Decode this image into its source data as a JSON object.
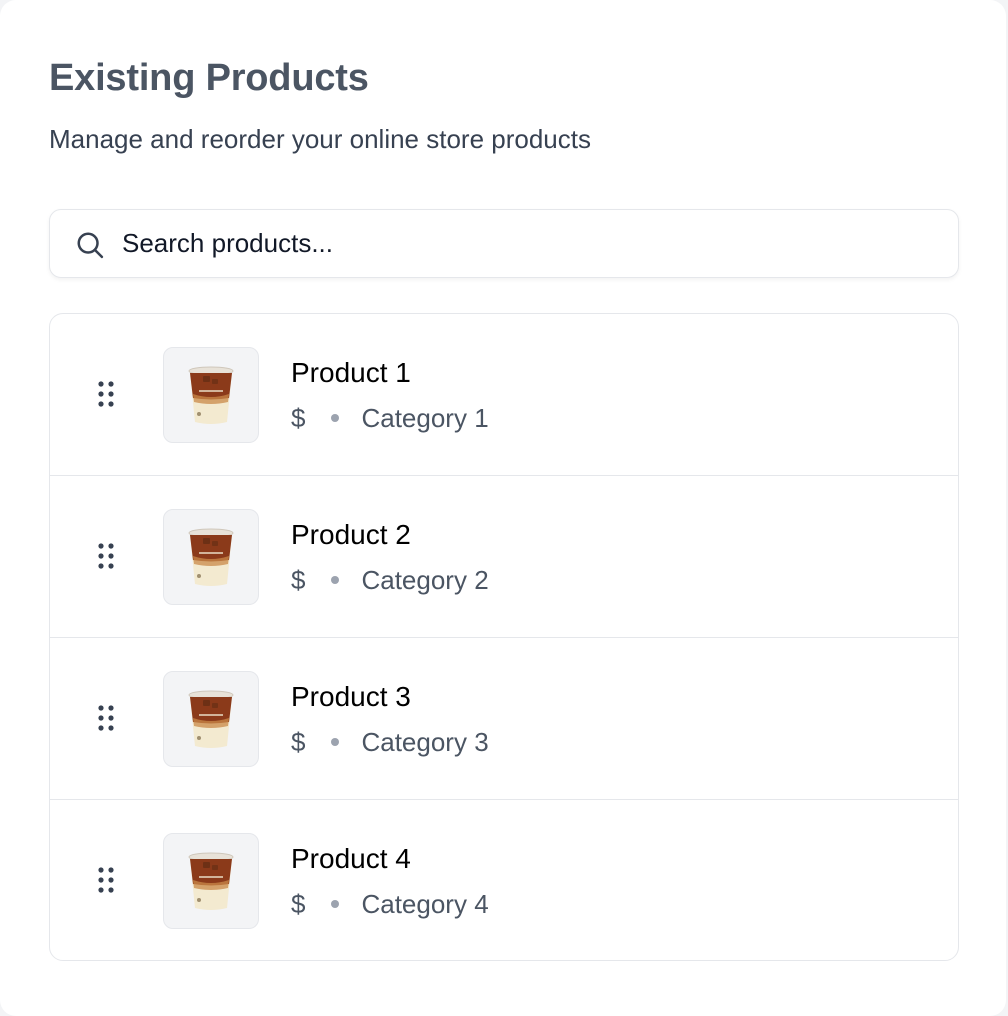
{
  "header": {
    "title": "Existing Products",
    "subtitle": "Manage and reorder your online store products"
  },
  "search": {
    "placeholder": "Search products...",
    "value": "",
    "icon": "search-icon"
  },
  "products": [
    {
      "name": "Product 1",
      "price": "$",
      "category": "Category 1",
      "image": "iced-coffee-cup-image"
    },
    {
      "name": "Product 2",
      "price": "$",
      "category": "Category 2",
      "image": "iced-coffee-cup-image"
    },
    {
      "name": "Product 3",
      "price": "$",
      "category": "Category 3",
      "image": "iced-coffee-cup-image"
    },
    {
      "name": "Product 4",
      "price": "$",
      "category": "Category 4",
      "image": "iced-coffee-cup-image"
    }
  ],
  "colors": {
    "title": "#4b5563",
    "border": "#e5e7eb",
    "thumb_bg": "#f3f4f6",
    "coffee": "#8b3a1a",
    "milk": "#f3ead0"
  }
}
